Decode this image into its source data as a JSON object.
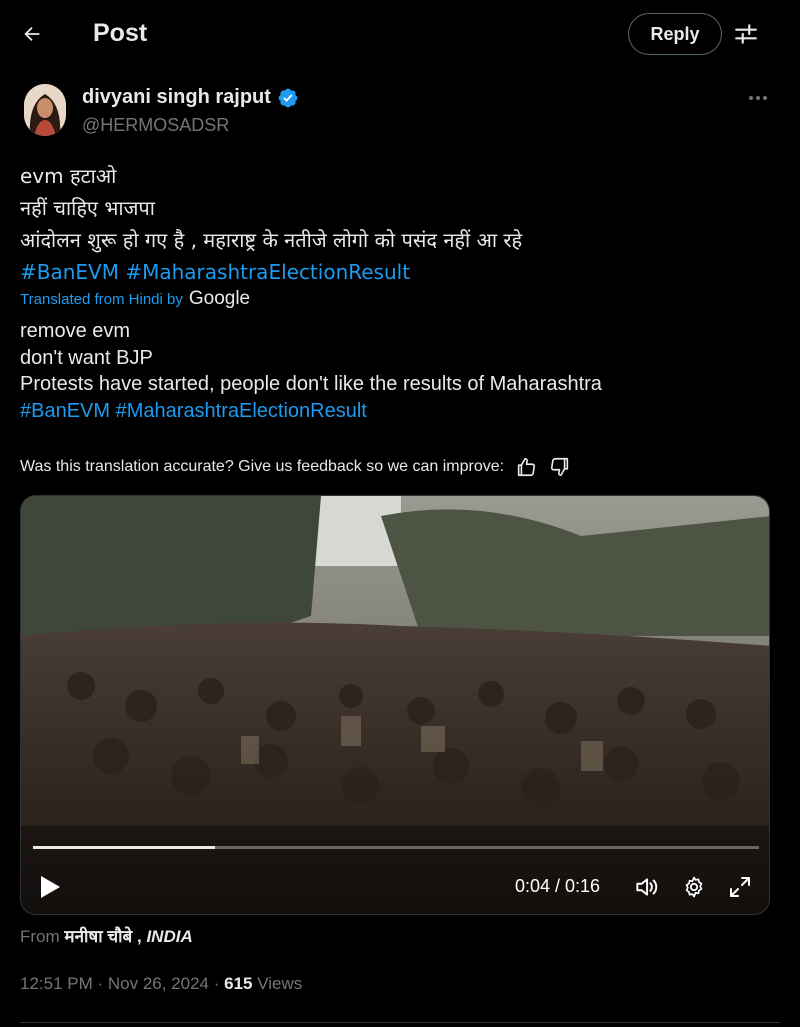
{
  "header": {
    "title": "Post",
    "reply_label": "Reply"
  },
  "author": {
    "name": "divyani singh rajput",
    "handle": "@HERMOSADSR",
    "verified": true
  },
  "tweet": {
    "lines": [
      "evm हटाओ",
      "नहीं चाहिए भाजपा",
      "आंदोलन शुरू हो गए है , महाराष्ट्र के नतीजे लोगो को पसंद नहीं आ रहे"
    ],
    "hashtags": [
      "#BanEVM",
      "#MaharashtraElectionResult"
    ]
  },
  "translation": {
    "label": "Translated from Hindi by",
    "provider": "Google",
    "lines": [
      "remove evm",
      "don't want BJP",
      "Protests have started, people don't like the results of Maharashtra"
    ],
    "hashtags": [
      "#BanEVM",
      "#MaharashtraElectionResult"
    ]
  },
  "feedback": {
    "question": "Was this translation accurate? Give us feedback so we can improve:"
  },
  "video": {
    "time_display": "0:04 / 0:16",
    "progress": 0.25
  },
  "source": {
    "prefix": "From",
    "name": "मनीषा चौबे",
    "separator": " , ",
    "location": "INDIA"
  },
  "meta": {
    "time": "12:51 PM",
    "dot": " · ",
    "date": "Nov 26, 2024",
    "views_count": "615",
    "views_label": "Views"
  },
  "colors": {
    "background": "#000000",
    "text": "#e7e9ea",
    "secondary": "#71767b",
    "link": "#1d9bf0",
    "verified": "#1d9bf0"
  },
  "icons": [
    "back-arrow-icon",
    "filter-sliders-icon",
    "verified-badge-icon",
    "more-dots-icon",
    "thumbs-up-icon",
    "thumbs-down-icon",
    "play-icon",
    "volume-icon",
    "settings-gear-icon",
    "fullscreen-icon"
  ]
}
